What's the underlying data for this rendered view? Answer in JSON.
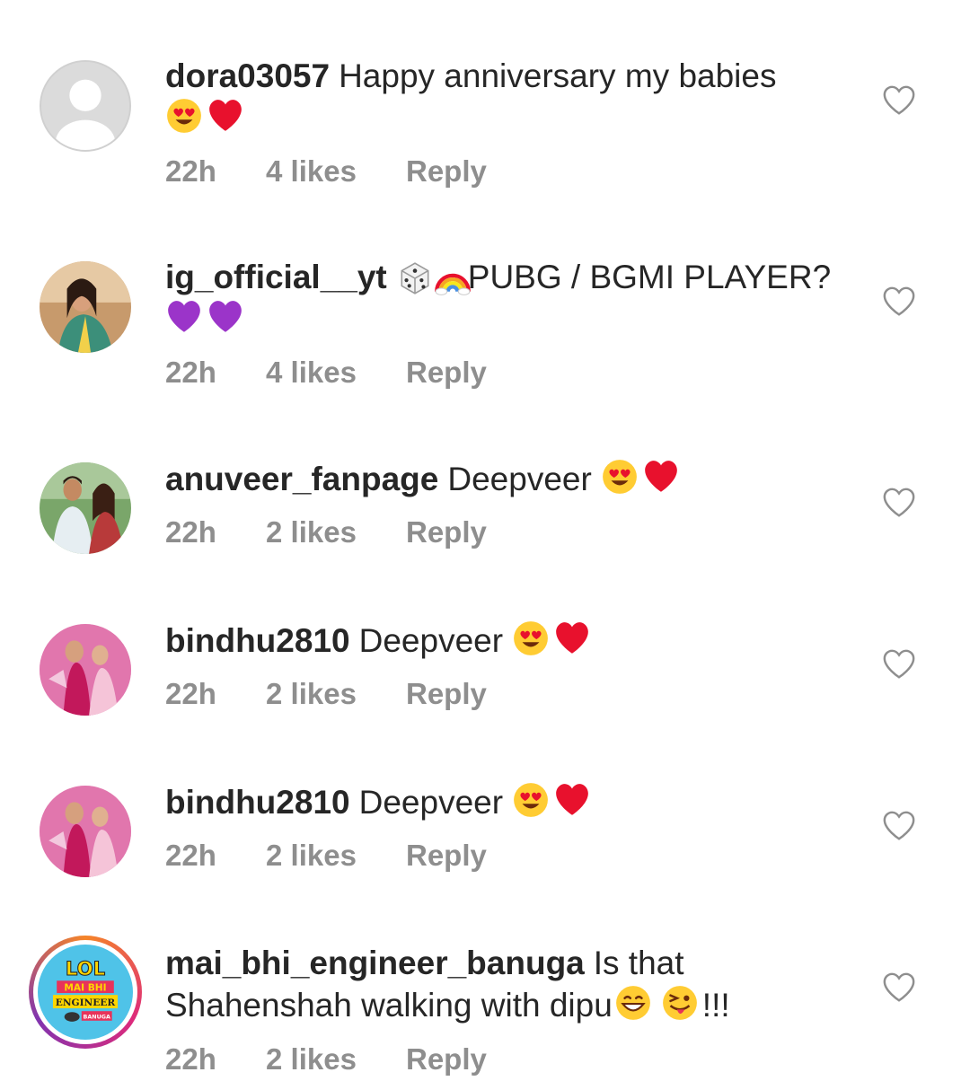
{
  "comments": [
    {
      "username": "dora03057",
      "text_before": "Happy anniversary my babies",
      "emojis_after": [
        "heart-eyes-emoji",
        "red-heart-emoji"
      ],
      "text_after": "",
      "time": "22h",
      "likes": "4 likes",
      "reply": "Reply",
      "avatar": "default-avatar"
    },
    {
      "username": "ig_official__yt",
      "text_prefix_emojis": [
        "dice-emoji",
        "rainbow-emoji"
      ],
      "text_before": "PUBG / BGMI PLAYER?",
      "emojis_after": [
        "purple-heart-emoji",
        "purple-heart-emoji"
      ],
      "text_after": "",
      "time": "22h",
      "likes": "4 likes",
      "reply": "Reply",
      "avatar": "photo-avatar"
    },
    {
      "username": "anuveer_fanpage",
      "text_before": "Deepveer",
      "emojis_after": [
        "heart-eyes-emoji",
        "red-heart-emoji"
      ],
      "text_after": "",
      "time": "22h",
      "likes": "2 likes",
      "reply": "Reply",
      "avatar": "photo-avatar"
    },
    {
      "username": "bindhu2810",
      "text_before": "Deepveer",
      "emojis_after": [
        "heart-eyes-emoji",
        "red-heart-emoji"
      ],
      "text_after": "",
      "time": "22h",
      "likes": "2 likes",
      "reply": "Reply",
      "avatar": "photo-avatar"
    },
    {
      "username": "bindhu2810",
      "text_before": "Deepveer",
      "emojis_after": [
        "heart-eyes-emoji",
        "red-heart-emoji"
      ],
      "text_after": "",
      "time": "22h",
      "likes": "2 likes",
      "reply": "Reply",
      "avatar": "photo-avatar"
    },
    {
      "username": "mai_bhi_engineer_banuga",
      "text_before": "Is that Shahenshah walking with dipu",
      "emojis_after": [
        "grinning-emoji",
        "winking-tongue-emoji"
      ],
      "text_after": "!!!",
      "time": "22h",
      "likes": "2 likes",
      "reply": "Reply",
      "avatar": "story-ring-avatar",
      "avatar_logo": {
        "line1": "LOL",
        "line2": "MAI BHI",
        "line3": "ENGINEER",
        "line4": "BANUGA"
      }
    }
  ],
  "icons": {
    "like": "heart-outline-icon"
  },
  "colors": {
    "text": "#262626",
    "secondary": "#8e8e8e",
    "background": "#ffffff"
  }
}
